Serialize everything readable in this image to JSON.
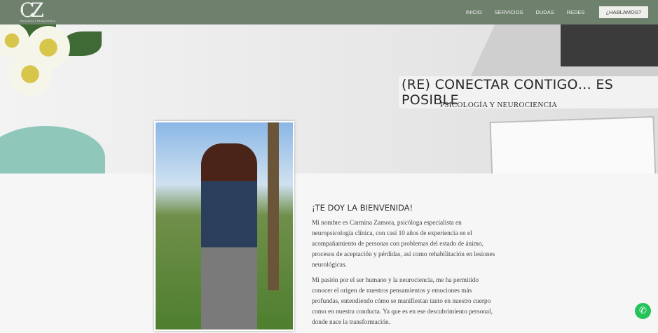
{
  "nav": {
    "logo_text": "CZ",
    "logo_sub": "PSICOLOGÍA Y NEUROCIENCIA",
    "items": [
      {
        "label": "INICIO"
      },
      {
        "label": "SERVICIOS"
      },
      {
        "label": "DUDAS"
      },
      {
        "label": "REDES"
      }
    ],
    "cta": "¿HABLAMOS?"
  },
  "hero": {
    "title": "(RE) CONECTAR CONTIGO… ES POSIBLE",
    "subtitle": "PSICOLOGÍA Y NEUROCIENCIA"
  },
  "welcome": {
    "heading": "¡TE DOY LA BIENVENIDA!",
    "paragraphs": [
      "Mi nombre es Carmina Zamora, psicóloga especialista en neuropsicología clínica, con casi 10 años de experiencia en el acompañamiento de personas con problemas del estado de ánimo, procesos de aceptación y pérdidas, así como rehabilitación en lesiones neurológicas.",
      "Mi pasión por el ser humano y la neurociencia, me ha permitido conocer el origen de nuestros pensamientos y emociones más profundas, entendiendo cómo se manifiestan tanto en nuestro cuerpo como en nuestra conducta. Ya que es en ese descubrimiento personal, donde nace la transformación."
    ]
  },
  "whatsapp": {
    "icon": "whatsapp-icon",
    "color": "#25c45a"
  },
  "colors": {
    "nav": "#6e816d"
  }
}
